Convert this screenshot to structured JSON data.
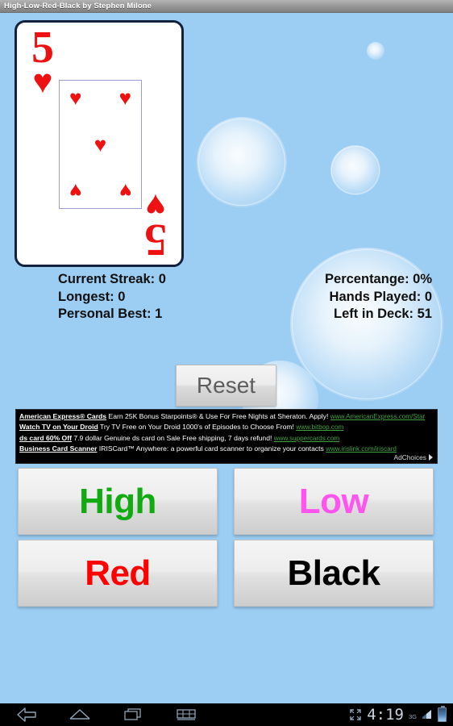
{
  "titlebar": {
    "title": "High-Low-Red-Black by Stephen Milone"
  },
  "card": {
    "rank": "5",
    "suit_symbol": "♥",
    "suit_name": "hearts",
    "color": "#ee1111",
    "pip_count": 5,
    "inner_box_color": "#9b9bcf"
  },
  "stats": {
    "left": [
      "Current Streak: 0",
      "Longest: 0",
      "Personal Best: 1"
    ],
    "right": [
      "Percentange: 0%",
      "Hands Played: 0",
      "Left in Deck: 51"
    ]
  },
  "reset": {
    "label": "Reset"
  },
  "ad": {
    "rows": [
      {
        "headline": "American Express® Cards",
        "body": "Earn 25K Bonus Starpoints® & Use For Free Nights at Sheraton. Apply!",
        "url": "www.AmericanExpress.com/Star"
      },
      {
        "headline": "Watch TV on Your Droid",
        "body": "Try TV Free on Your Droid 1000's of Episodes to Choose From!",
        "url": "www.bitbop.com"
      },
      {
        "headline": "ds card 60% Off",
        "body": "7.9 dollar Genuine ds card on Sale Free shipping, 7 days refund!",
        "url": "www.suppercards.com"
      },
      {
        "headline": "Business Card Scanner",
        "body": "IRISCard™ Anywhere: a powerful card scanner to organize your contacts",
        "url": "www.irislink.com/iriscard"
      }
    ],
    "adchoices_label": "AdChoices"
  },
  "choices": [
    {
      "label": "High",
      "color": "#11aa11"
    },
    {
      "label": "Low",
      "color": "#ff55ee"
    },
    {
      "label": "Red",
      "color": "#ff0000"
    },
    {
      "label": "Black",
      "color": "#000000"
    }
  ],
  "system_bar": {
    "nav": [
      "back-icon",
      "home-icon",
      "recents-icon",
      "keyboard-icon"
    ],
    "fullscreen_icon": "expand-icon",
    "clock": "4:19",
    "network": "3G",
    "battery_icon": "battery-charging-icon"
  }
}
